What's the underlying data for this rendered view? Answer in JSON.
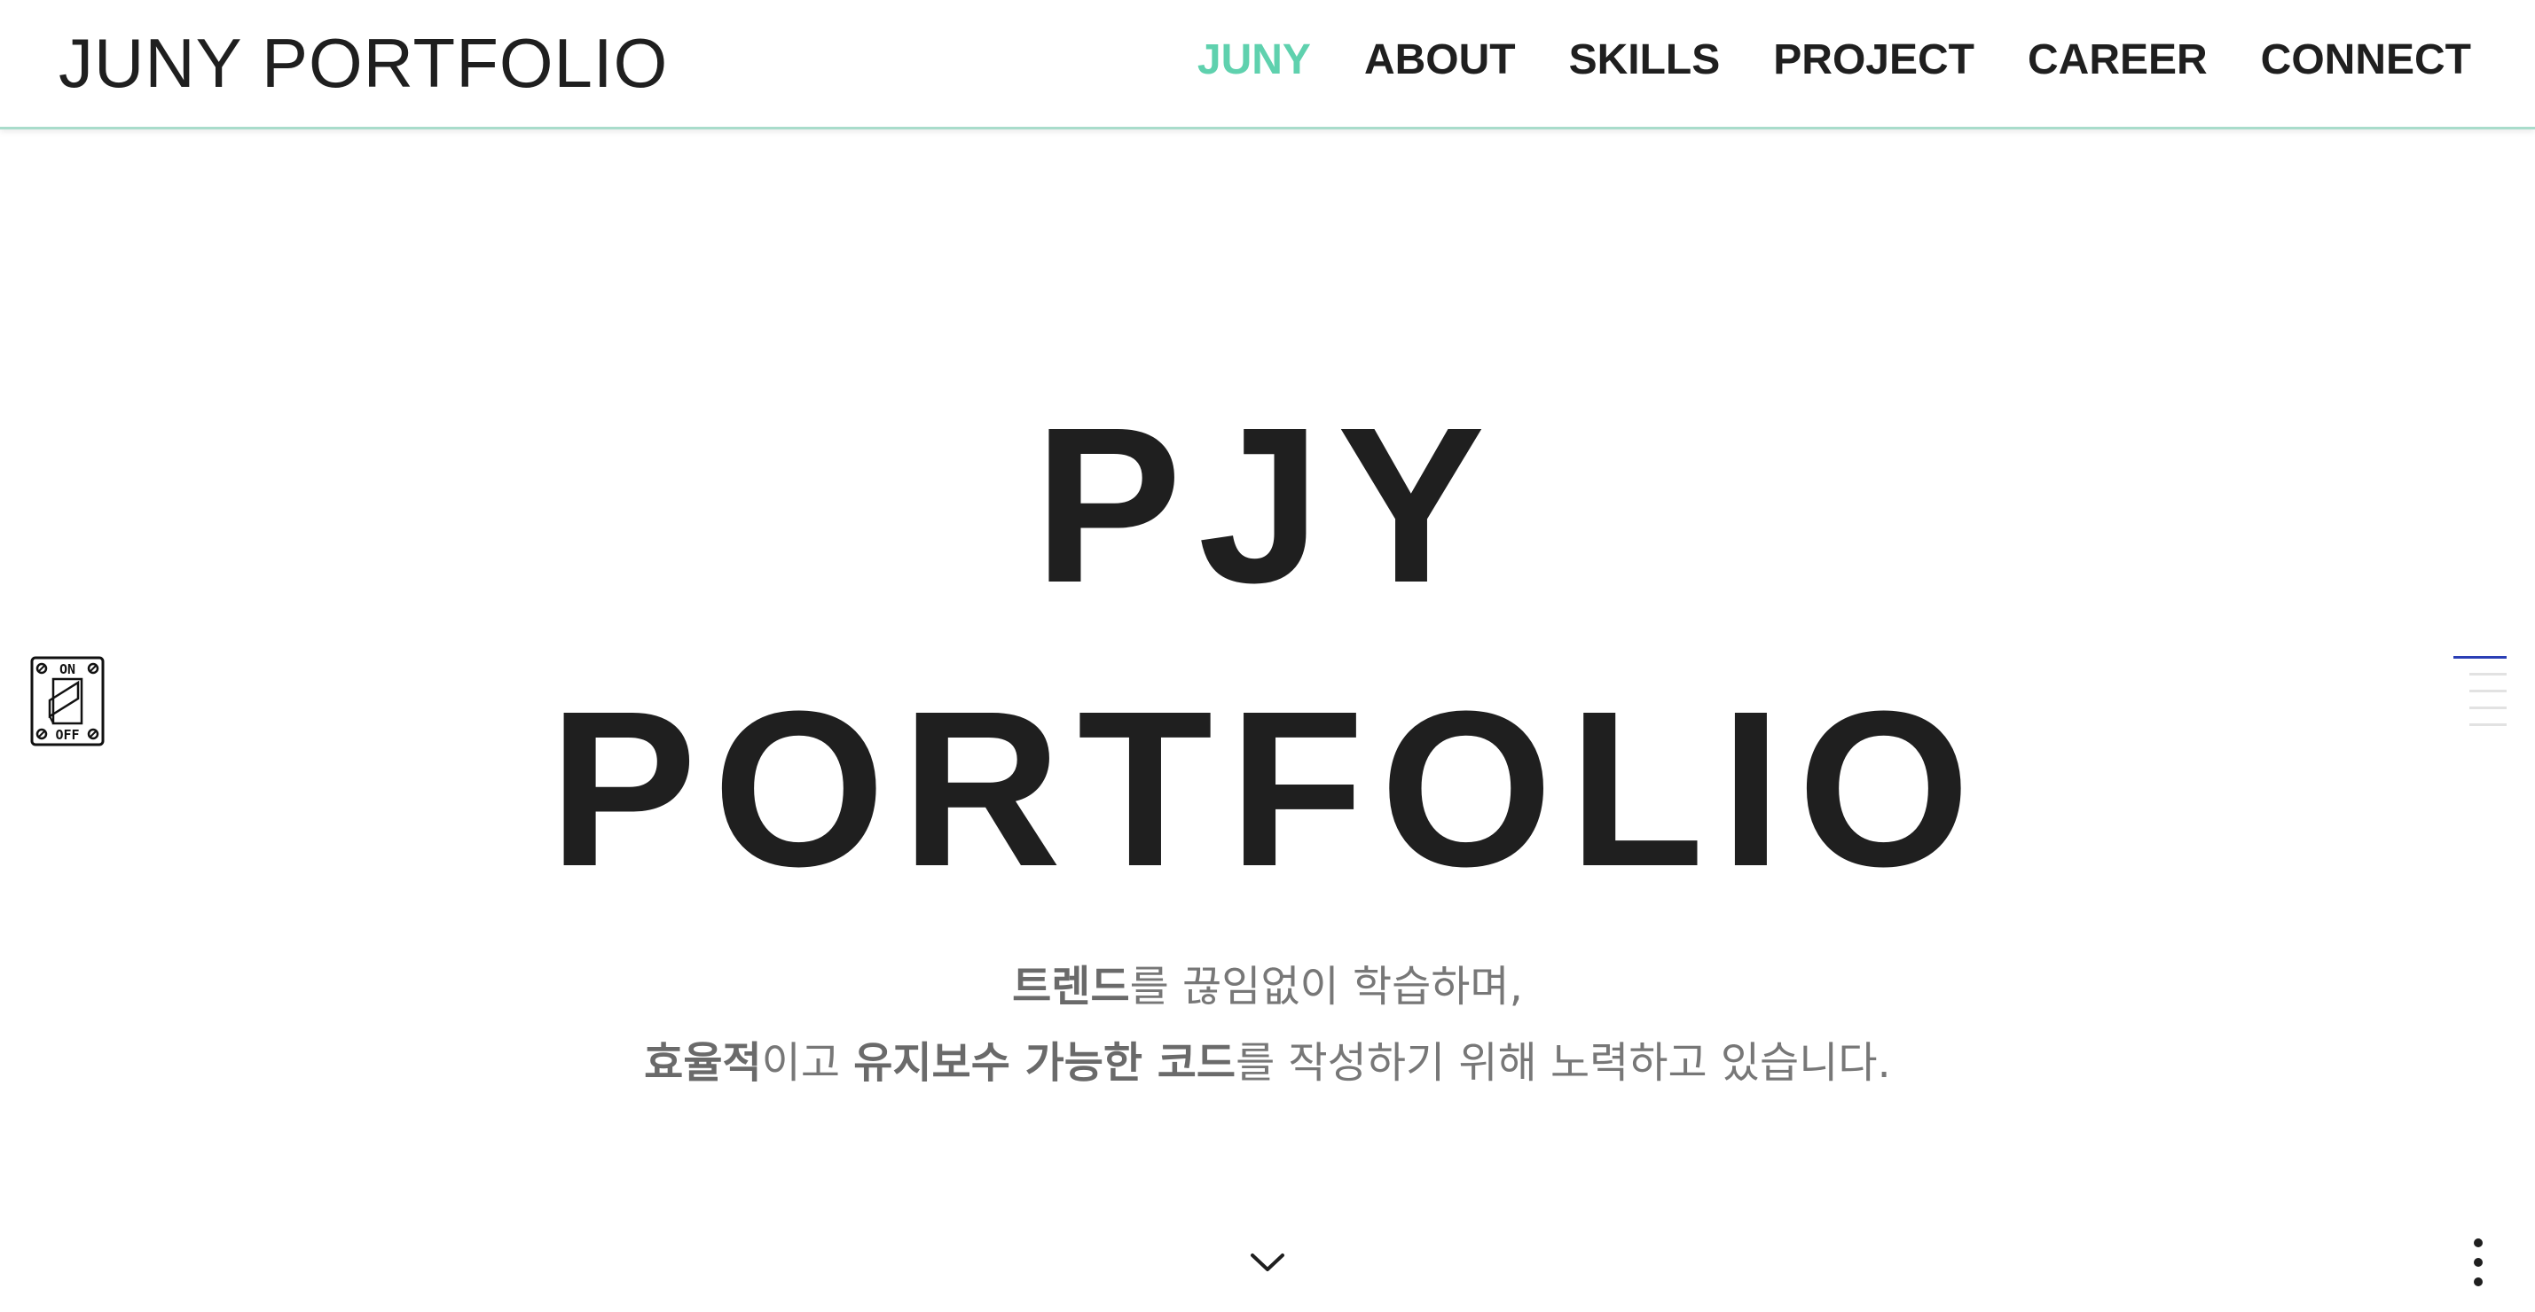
{
  "header": {
    "logo": "JUNY PORTFOLIO",
    "nav": [
      {
        "label": "JUNY",
        "active": true
      },
      {
        "label": "ABOUT",
        "active": false
      },
      {
        "label": "SKILLS",
        "active": false
      },
      {
        "label": "PROJECT",
        "active": false
      },
      {
        "label": "CAREER",
        "active": false
      },
      {
        "label": "CONNECT",
        "active": false
      }
    ]
  },
  "hero": {
    "title_line1": "PJY",
    "title_line2": "PORTFOLIO",
    "line1": {
      "bold1": "트렌드",
      "text1": "를 끊임없이 학습하며,"
    },
    "line2": {
      "bold1": "효율적",
      "text1": "이고 ",
      "bold2": "유지보수 가능한 코드",
      "text2": "를 작성하기 위해 노력하고 있습니다."
    }
  },
  "switch": {
    "on_label": "ON",
    "off_label": "OFF"
  },
  "icons": {
    "scroll": "chevron-down-icon",
    "menu": "kebab-menu-icon"
  },
  "colors": {
    "accent": "#5fd1ae",
    "indicator_active": "#2a3fb5",
    "text": "#1f1f1f",
    "subtext": "#777777"
  }
}
